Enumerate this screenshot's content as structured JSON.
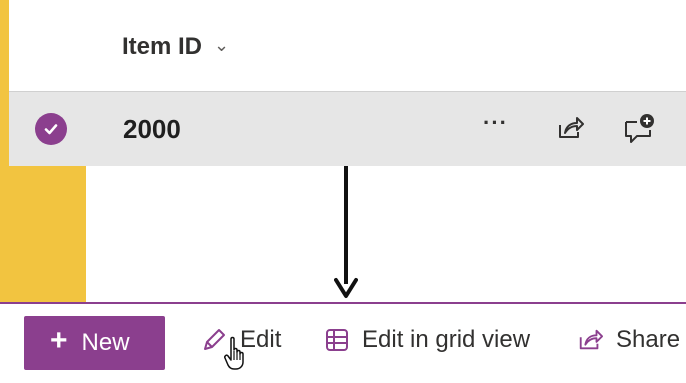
{
  "list": {
    "column_header": "Item ID",
    "row": {
      "item_id": "2000",
      "more_label": "···"
    }
  },
  "command_bar": {
    "new_label": "New",
    "edit_label": "Edit",
    "edit_grid_label": "Edit in grid view",
    "share_label": "Share"
  },
  "colors": {
    "accent": "#8b3f8e",
    "side_stripe": "#f2c440",
    "selected_row": "#e6e6e6"
  }
}
